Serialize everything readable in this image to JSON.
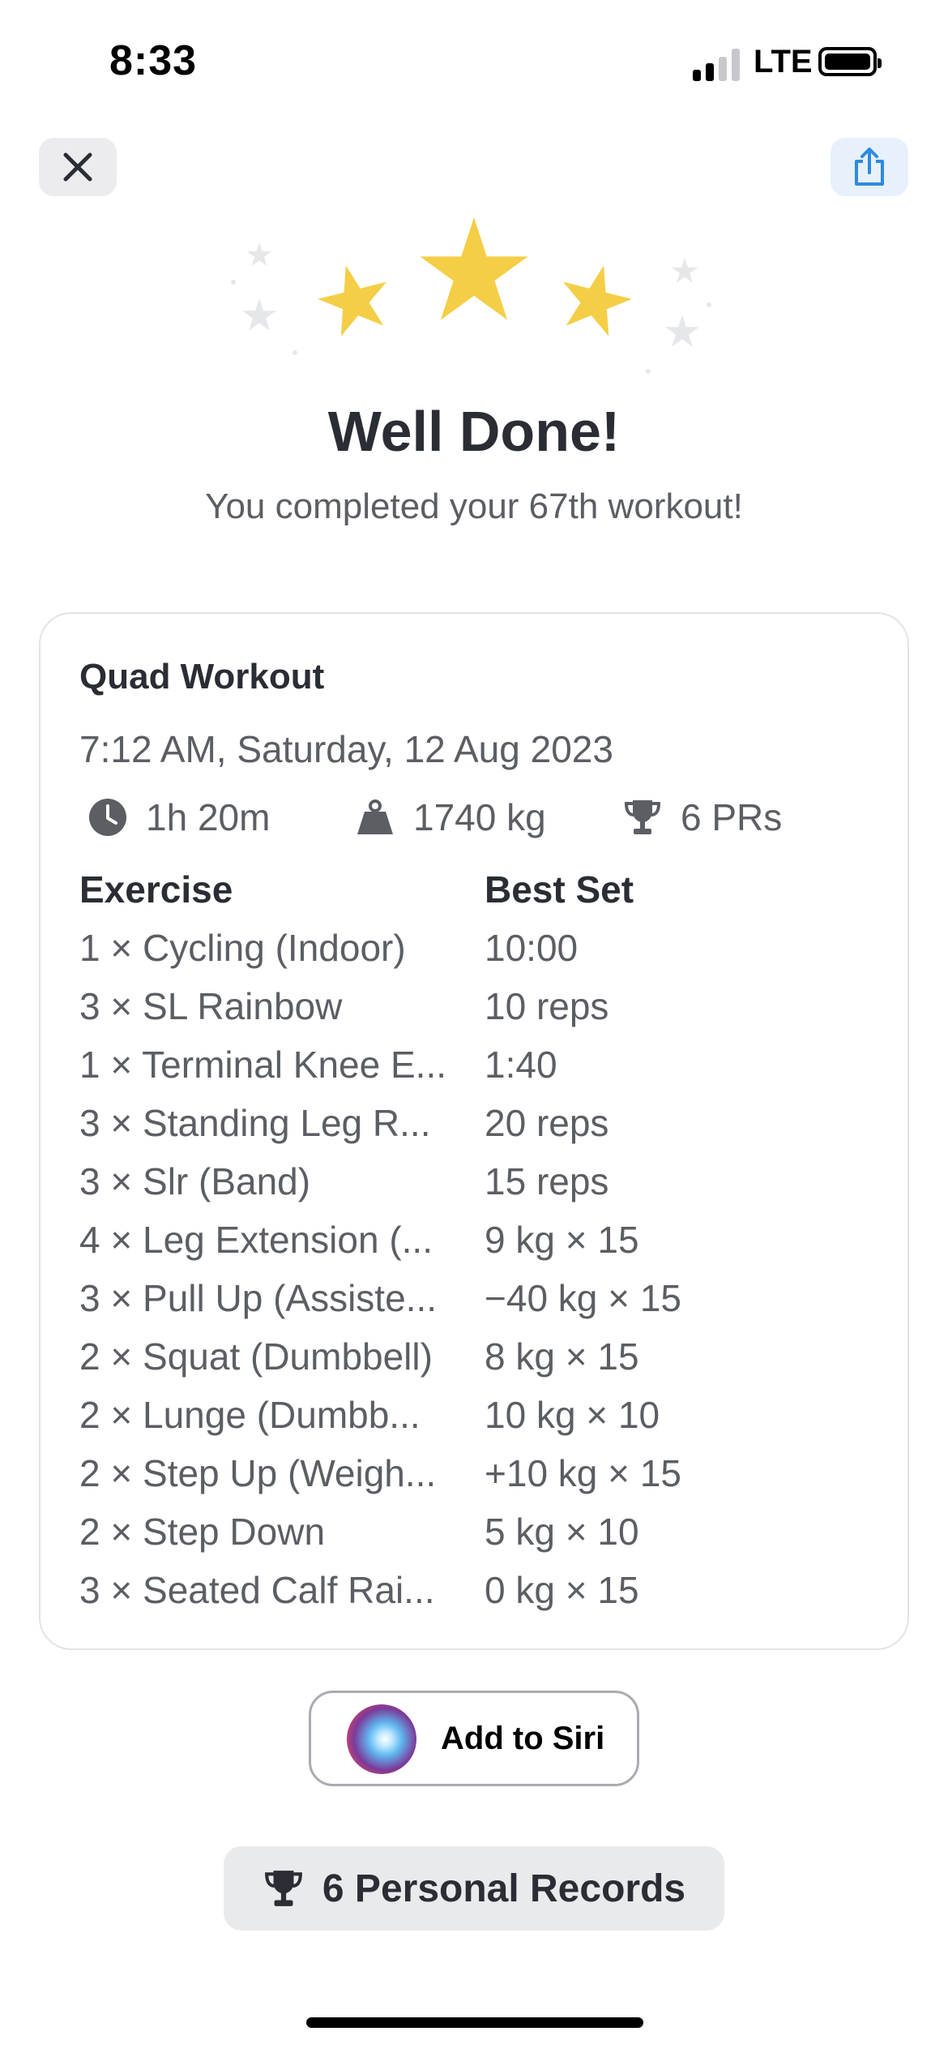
{
  "status_bar": {
    "time": "8:33",
    "network": "LTE"
  },
  "header": {
    "close_icon": "close-icon",
    "share_icon": "share-icon"
  },
  "celebration": {
    "title": "Well Done!",
    "subtitle": "You completed your 67th workout!",
    "star_color": "#F5CE47"
  },
  "workout": {
    "name": "Quad Workout",
    "datetime": "7:12 AM, Saturday, 12 Aug 2023",
    "stats": {
      "duration": "1h 20m",
      "volume": "1740 kg",
      "prs": "6 PRs"
    },
    "columns": {
      "exercise": "Exercise",
      "best_set": "Best Set"
    },
    "exercises": [
      {
        "name": "1 × Cycling (Indoor)",
        "best_set": "10:00"
      },
      {
        "name": "3 × SL Rainbow",
        "best_set": "10 reps"
      },
      {
        "name": "1 × Terminal Knee E...",
        "best_set": "1:40"
      },
      {
        "name": "3 × Standing Leg R...",
        "best_set": "20 reps"
      },
      {
        "name": "3 × Slr (Band)",
        "best_set": "15 reps"
      },
      {
        "name": "4 × Leg Extension (...",
        "best_set": "9 kg × 15"
      },
      {
        "name": "3 × Pull Up (Assiste...",
        "best_set": "−40 kg × 15"
      },
      {
        "name": "2 × Squat (Dumbbell)",
        "best_set": "8 kg × 15"
      },
      {
        "name": "2 × Lunge (Dumbb...",
        "best_set": "10 kg × 10"
      },
      {
        "name": "2 × Step Up (Weigh...",
        "best_set": "+10 kg × 15"
      },
      {
        "name": "2 × Step Down",
        "best_set": "5 kg × 10"
      },
      {
        "name": "3 × Seated Calf Rai...",
        "best_set": "0 kg × 15"
      }
    ]
  },
  "actions": {
    "siri_label": "Add to Siri",
    "records_label": "6 Personal Records"
  }
}
